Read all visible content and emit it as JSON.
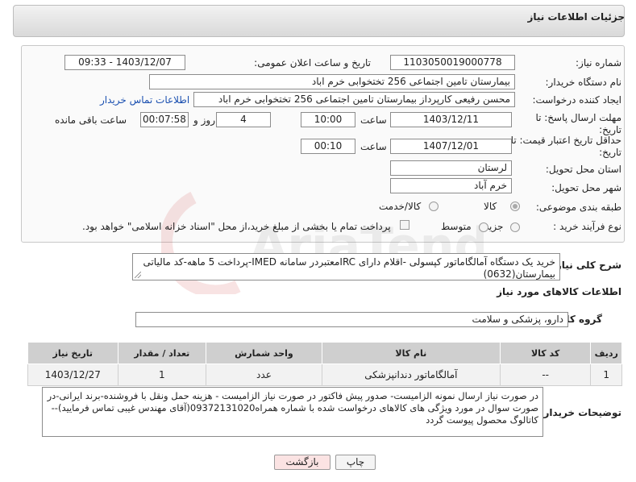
{
  "page_title": "جزئیات اطلاعات نیاز",
  "need_number": {
    "label": "شماره نیاز:",
    "value": "1103050019000778"
  },
  "announce": {
    "label": "تاریخ و ساعت اعلان عمومی:",
    "value": "1403/12/07 - 09:33"
  },
  "buyer_org": {
    "label": "نام دستگاه خریدار:",
    "value": "بیمارستان تامین اجتماعی  256 تختخوابی خرم اباد"
  },
  "creator": {
    "label": "ایجاد کننده درخواست:",
    "value": "محسن رفیعی کارپرداز بیمارستان تامین اجتماعی  256 تختخوابی خرم اباد",
    "contact_link": "اطلاعات تماس خریدار"
  },
  "deadline": {
    "label_line1": "مهلت ارسال پاسخ: تا",
    "label_line2": "تاریخ:",
    "date": "1403/12/11",
    "time_label": "ساعت",
    "time": "10:00",
    "days": "4",
    "days_label": "روز و",
    "remaining": "00:07:58",
    "remaining_label": "ساعت باقی مانده"
  },
  "validity": {
    "label_line1": "حداقل تاریخ اعتبار قیمت: تا",
    "label_line2": "تاریخ:",
    "date": "1407/12/01",
    "time_label": "ساعت",
    "time": "00:10"
  },
  "province": {
    "label": "استان محل تحویل:",
    "value": "لرستان"
  },
  "city": {
    "label": "شهر محل تحویل:",
    "value": "خرم آباد"
  },
  "category": {
    "label": "طبقه بندی موضوعی:",
    "options": [
      "کالا",
      "کالا/خدمت"
    ],
    "selected": "کالا"
  },
  "purchase_process": {
    "label": "نوع فرآیند خرید :",
    "options": [
      "جزیی",
      "متوسط"
    ],
    "payment_note": "پرداخت تمام یا بخشی از مبلغ خرید،از محل \"اسناد خزانه اسلامی\" خواهد بود."
  },
  "description": {
    "label": "شرح کلی نیاز:",
    "line1": "خرید یک دستگاه آمالگاماتور کپسولی -اقلام دارای IRCمعتبردر سامانه IMED-پرداخت 5 ماهه-کد مالیاتی",
    "line2": "بیمارستان(0632)"
  },
  "goods_info_heading": "اطلاعات کالاهای مورد نیاز",
  "goods_group": {
    "label": "گروه کالا:",
    "value": "دارو، پزشکی و سلامت"
  },
  "table": {
    "headers": [
      "ردیف",
      "کد کالا",
      "نام کالا",
      "واحد شمارش",
      "تعداد / مقدار",
      "تاریخ نیاز"
    ],
    "rows": [
      [
        "1",
        "--",
        "آمالگاماتور دندانپزشکی",
        "عدد",
        "1",
        "1403/12/27"
      ]
    ]
  },
  "buyer_notes": {
    "label": "توضیحات خریدار:",
    "line1": "در صورت نیاز ارسال نمونه الزامیست- صدور پیش فاکتور در صورت نیاز الزامیست - هزینه حمل ونقل با فروشنده-برند ایرانی-در",
    "line2": "صورت سوال در مورد ویژگی های کالاهای درخواست شده با شماره همراه09372131020(آقای مهندس غیبی تماس فرمایید)--",
    "line3": "کاتالوگ محصول پیوست گردد"
  },
  "buttons": {
    "print": "چاپ",
    "back": "بازگشت"
  },
  "watermark_text": "AriaTender.neT",
  "colors": {
    "accent_link": "#1a4fb0",
    "back_button_bg": "#fbe3e3"
  }
}
